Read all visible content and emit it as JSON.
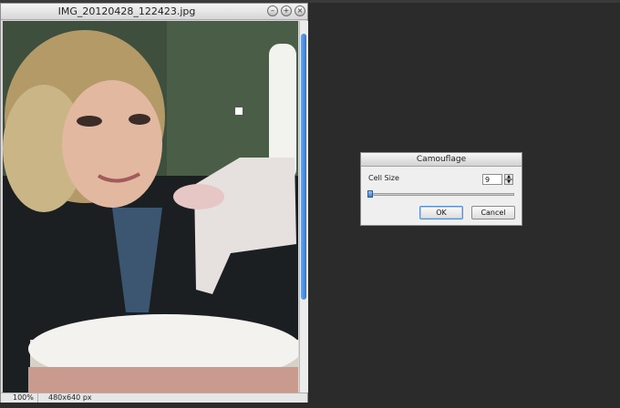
{
  "document": {
    "title": "IMG_20120428_122423.jpg",
    "zoom": "100%",
    "dimensions": "480x640 px",
    "window_buttons": [
      "minimize-icon",
      "maximize-icon",
      "close-icon"
    ]
  },
  "dialog": {
    "title": "Camouflage",
    "cell_size_label": "Cell Size",
    "cell_size_value": "9",
    "ok_label": "OK",
    "cancel_label": "Cancel"
  }
}
